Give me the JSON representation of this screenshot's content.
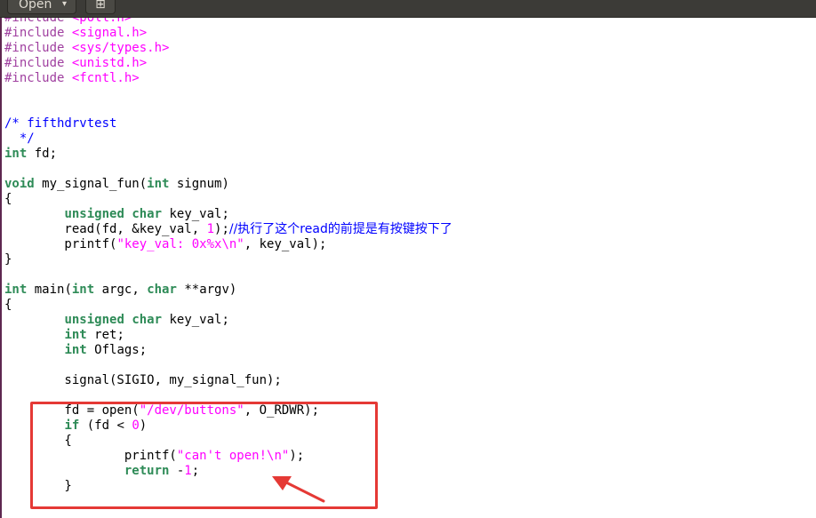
{
  "toolbar": {
    "open_label": "Open",
    "open_chevron": "▾",
    "icon_glyph": "⊞"
  },
  "code": {
    "lines": [
      [
        {
          "t": "#include ",
          "c": "pp"
        },
        {
          "t": "<poll.h>",
          "c": "inc"
        }
      ],
      [
        {
          "t": "#include ",
          "c": "pp"
        },
        {
          "t": "<signal.h>",
          "c": "inc"
        }
      ],
      [
        {
          "t": "#include ",
          "c": "pp"
        },
        {
          "t": "<sys/types.h>",
          "c": "inc"
        }
      ],
      [
        {
          "t": "#include ",
          "c": "pp"
        },
        {
          "t": "<unistd.h>",
          "c": "inc"
        }
      ],
      [
        {
          "t": "#include ",
          "c": "pp"
        },
        {
          "t": "<fcntl.h>",
          "c": "inc"
        }
      ],
      [],
      [],
      [
        {
          "t": "/* fifthdrvtest",
          "c": "cm"
        }
      ],
      [
        {
          "t": "  */",
          "c": "cm"
        }
      ],
      [
        {
          "t": "int",
          "c": "kw"
        },
        {
          "t": " fd;"
        }
      ],
      [],
      [
        {
          "t": "void",
          "c": "kw"
        },
        {
          "t": " my_signal_fun("
        },
        {
          "t": "int",
          "c": "kw"
        },
        {
          "t": " signum)"
        }
      ],
      [
        {
          "t": "{"
        }
      ],
      [
        {
          "t": "        "
        },
        {
          "t": "unsigned",
          "c": "kw"
        },
        {
          "t": " "
        },
        {
          "t": "char",
          "c": "kw"
        },
        {
          "t": " key_val;"
        }
      ],
      [
        {
          "t": "        read(fd, &key_val, "
        },
        {
          "t": "1",
          "c": "nu"
        },
        {
          "t": ");"
        },
        {
          "t": "//执行了这个read的前提是有按键按下了",
          "c": "cm cjk"
        }
      ],
      [
        {
          "t": "        printf("
        },
        {
          "t": "\"key_val: 0x%x\\n\"",
          "c": "st"
        },
        {
          "t": ", key_val);"
        }
      ],
      [
        {
          "t": "}"
        }
      ],
      [],
      [
        {
          "t": "int",
          "c": "kw"
        },
        {
          "t": " main("
        },
        {
          "t": "int",
          "c": "kw"
        },
        {
          "t": " argc, "
        },
        {
          "t": "char",
          "c": "kw"
        },
        {
          "t": " **argv)"
        }
      ],
      [
        {
          "t": "{"
        }
      ],
      [
        {
          "t": "        "
        },
        {
          "t": "unsigned",
          "c": "kw"
        },
        {
          "t": " "
        },
        {
          "t": "char",
          "c": "kw"
        },
        {
          "t": " key_val;"
        }
      ],
      [
        {
          "t": "        "
        },
        {
          "t": "int",
          "c": "kw"
        },
        {
          "t": " ret;"
        }
      ],
      [
        {
          "t": "        "
        },
        {
          "t": "int",
          "c": "kw"
        },
        {
          "t": " Oflags;"
        }
      ],
      [],
      [
        {
          "t": "        signal(SIGIO, my_signal_fun);"
        }
      ],
      [],
      [
        {
          "t": "        fd = open("
        },
        {
          "t": "\"/dev/buttons\"",
          "c": "st"
        },
        {
          "t": ", O_RDWR);"
        }
      ],
      [
        {
          "t": "        "
        },
        {
          "t": "if",
          "c": "kw"
        },
        {
          "t": " (fd < "
        },
        {
          "t": "0",
          "c": "nu"
        },
        {
          "t": ")"
        }
      ],
      [
        {
          "t": "        {"
        }
      ],
      [
        {
          "t": "                printf("
        },
        {
          "t": "\"can't open!\\n\"",
          "c": "st"
        },
        {
          "t": ");"
        }
      ],
      [
        {
          "t": "                "
        },
        {
          "t": "return",
          "c": "kw"
        },
        {
          "t": " -"
        },
        {
          "t": "1",
          "c": "nu"
        },
        {
          "t": ";"
        }
      ],
      [
        {
          "t": "        }"
        }
      ]
    ]
  },
  "annotation": {
    "box_color": "#e53935",
    "arrow_color": "#e53935"
  }
}
